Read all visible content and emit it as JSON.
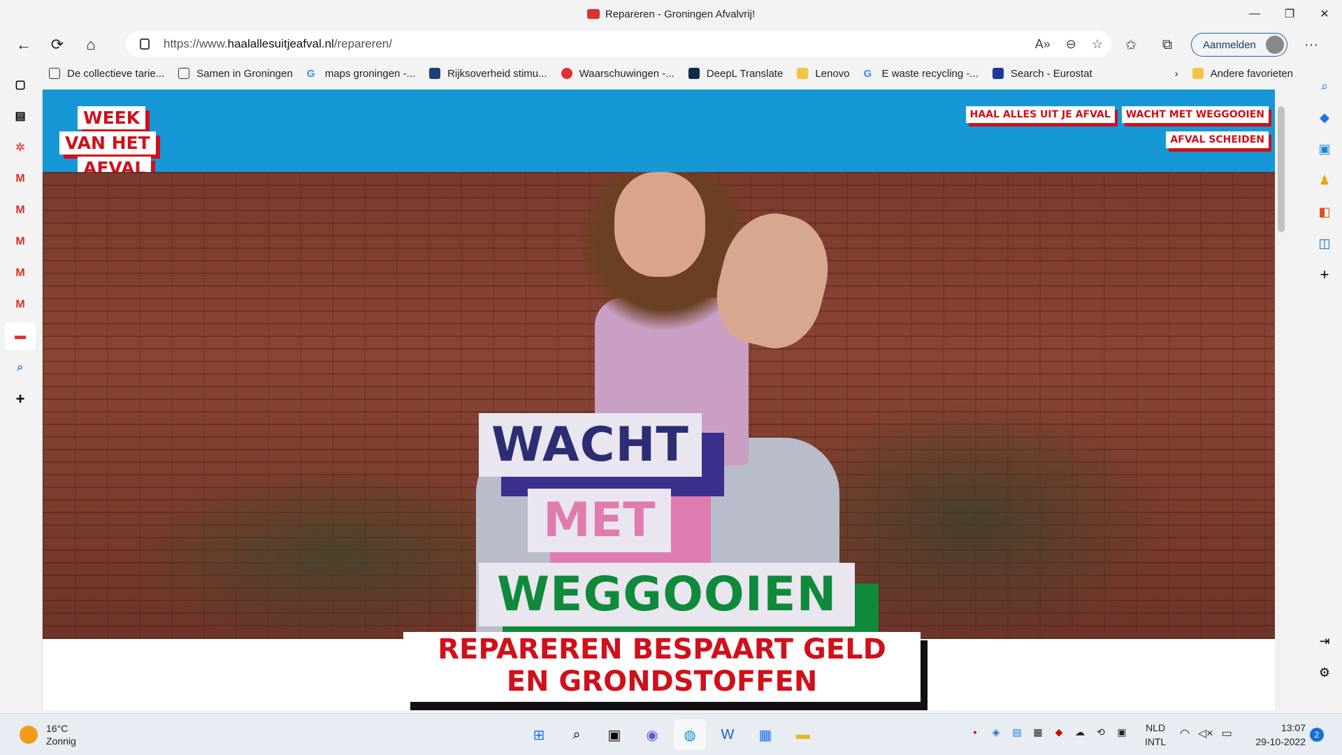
{
  "window": {
    "title": "Repareren - Groningen Afvalvrij!",
    "controls": [
      "—",
      "❐",
      "✕"
    ]
  },
  "toolbar": {
    "url_prefix": "https://www.",
    "url_host": "haalallesuitjeafval.nl",
    "url_path": "/repareren/",
    "signin_label": "Aanmelden"
  },
  "favorites": [
    {
      "label": "De collectieve tarie...",
      "color": "#ffffff"
    },
    {
      "label": "Samen in Groningen",
      "color": "#ffffff"
    },
    {
      "label": "maps groningen -...",
      "color": "#4285f4"
    },
    {
      "label": "Rijksoverheid stimu...",
      "color": "#1d3f7a"
    },
    {
      "label": "Waarschuwingen -...",
      "color": "#e0302f"
    },
    {
      "label": "DeepL Translate",
      "color": "#0f2b46"
    },
    {
      "label": "Lenovo",
      "color": "#f5c542"
    },
    {
      "label": "E waste recycling -...",
      "color": "#4285f4"
    },
    {
      "label": "Search - Eurostat",
      "color": "#1f3a93"
    }
  ],
  "favorites_more": "Andere favorieten",
  "site": {
    "logo": [
      "WEEK",
      "VAN HET",
      "AFVAL"
    ],
    "nav": [
      "HAAL ALLES UIT JE AFVAL",
      "WACHT MET WEGGOOIEN",
      "AFVAL SCHEIDEN"
    ],
    "hero": [
      "WACHT",
      "MET",
      "WEGGOOIEN"
    ],
    "cta_line1": "REPAREREN BESPAART GELD",
    "cta_line2": "EN GRONDSTOFFEN"
  },
  "taskbar": {
    "temperature": "16°C",
    "weather": "Zonnig",
    "lang1": "NLD",
    "lang2": "INTL",
    "time": "13:07",
    "date": "29-10-2022",
    "notifications": "2"
  }
}
